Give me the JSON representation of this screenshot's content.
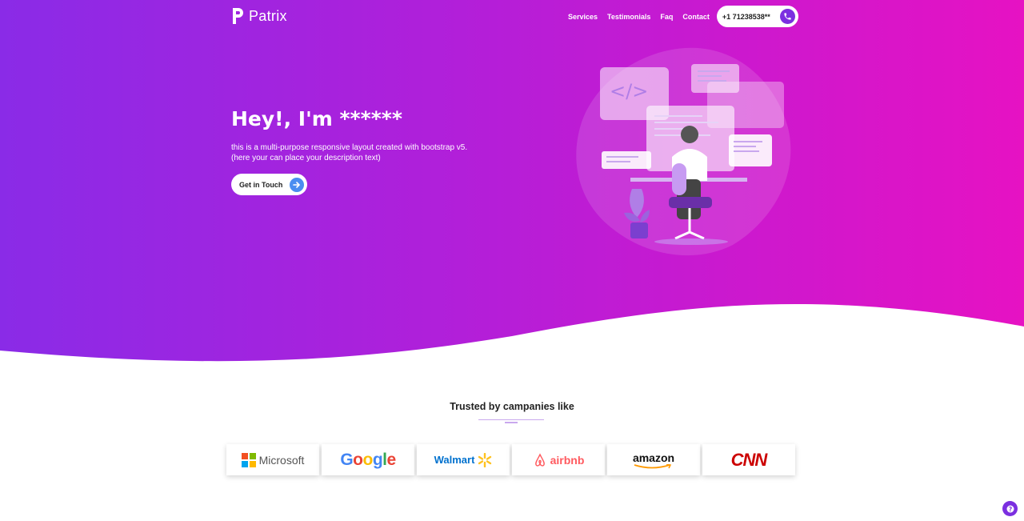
{
  "header": {
    "brand": "Patrix",
    "nav": [
      "Services",
      "Testimonials",
      "Faq",
      "Contact"
    ],
    "phone": "+1 71238538**"
  },
  "hero": {
    "title": "Hey!, I'm ******",
    "description_line1": "this is a multi-purpose responsive layout created with bootstrap v5.",
    "description_line2": "(here your can place your description text)",
    "cta_label": "Get in Touch"
  },
  "trusted": {
    "title": "Trusted by campanies like",
    "logos": [
      "Microsoft",
      "Google",
      "Walmart",
      "airbnb",
      "amazon",
      "CNN"
    ]
  },
  "colors": {
    "gradient_start": "#8a2be7",
    "gradient_end": "#e612c3",
    "accent": "#7b2fe0",
    "cta_icon": "#4a8df0"
  }
}
